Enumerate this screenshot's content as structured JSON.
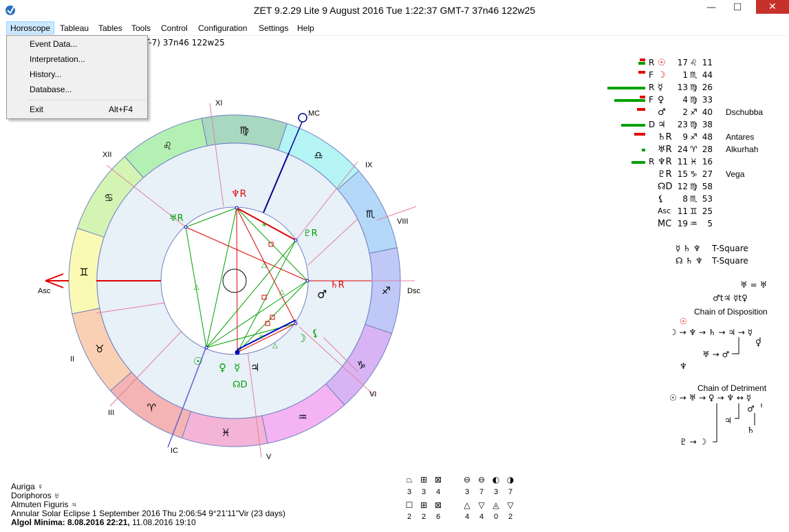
{
  "window": {
    "title": "ZET 9.2.29 Lite     9 August 2016   Tue     1:22:37 GMT-7 37n46   122w25",
    "minimize": "—",
    "maximize": "☐",
    "close": "✕"
  },
  "menubar": [
    "Horoscope",
    "Tableau",
    "Tables",
    "Tools",
    "Control",
    "Configuration",
    "Settings",
    "Help"
  ],
  "dropdown": {
    "items": [
      "Event Data...",
      "Interpretation...",
      "History...",
      "Database..."
    ],
    "exit": "Exit",
    "exit_accel": "Alt+F4"
  },
  "header_info": "T-7) 37n46  122w25",
  "wheel": {
    "houses": [
      "Asc",
      "II",
      "III",
      "IC",
      "V",
      "VI",
      "Dsc",
      "VIII",
      "IX",
      "MC",
      "XI",
      "XII"
    ],
    "signs": [
      "♊",
      "♋",
      "♌",
      "♍",
      "♎",
      "♏",
      "♐",
      "♑",
      "♒",
      "♓",
      "♈",
      "♉"
    ],
    "planet_glyphs": {
      "neptune_r": "♆R",
      "uranus_r": "♅R",
      "pluto_r": "♇R",
      "saturn_r": "♄R",
      "mars": "♂",
      "moon": "☽",
      "node": "☊",
      "mercury": "☿",
      "venus": "♀",
      "jupiter": "♃",
      "sun": "☉",
      "lilith": "⚸",
      "ceres": "⚳",
      "chiron_d": "☊D"
    },
    "colors": {
      "aries": "#f4b4b4",
      "taurus": "#fad0b4",
      "gemini": "#fafab4",
      "cancer": "#d4f4b4",
      "leo": "#b4f0b4",
      "virgo": "#a8d8c0",
      "libra": "#b4f4f4",
      "scorpio": "#b4d8f8",
      "sagittarius": "#c0c8f8",
      "capricorn": "#d8b4f4",
      "aquarius": "#f4b4f4",
      "pisces": "#f4b4d8",
      "inner": "#e8f0f8",
      "red": "#e00000",
      "green": "#00a000",
      "blue": "#0000c0"
    }
  },
  "planets": [
    {
      "flag": "R",
      "glyph": "☉",
      "deg": "17",
      "sign": "♌",
      "min": "11",
      "star": "",
      "red": 8,
      "green": 10,
      "color": "#e00000"
    },
    {
      "flag": "F",
      "glyph": "☽",
      "deg": "1",
      "sign": "♏",
      "min": "44",
      "star": "",
      "red": 10,
      "green": 0,
      "color": "#e00000"
    },
    {
      "flag": "R",
      "glyph": "☿",
      "deg": "13",
      "sign": "♍",
      "min": "26",
      "star": "",
      "red": 0,
      "green": 55,
      "color": "#000"
    },
    {
      "flag": "F",
      "glyph": "♀",
      "deg": "4",
      "sign": "♍",
      "min": "33",
      "star": "",
      "red": 8,
      "green": 45,
      "color": "#000"
    },
    {
      "flag": "",
      "glyph": "♂",
      "deg": "2",
      "sign": "♐",
      "min": "40",
      "star": "Dschubba",
      "red": 12,
      "green": 0,
      "color": "#000"
    },
    {
      "flag": "D",
      "glyph": "♃",
      "deg": "23",
      "sign": "♍",
      "min": "38",
      "star": "",
      "red": 0,
      "green": 35,
      "color": "#000"
    },
    {
      "flag": "",
      "glyph": "♄R",
      "deg": "9",
      "sign": "♐",
      "min": "48",
      "star": "Antares",
      "red": 16,
      "green": 0,
      "color": "#000"
    },
    {
      "flag": "",
      "glyph": "♅R",
      "deg": "24",
      "sign": "♈",
      "min": "28",
      "star": "Alkurhah",
      "red": 0,
      "green": 5,
      "color": "#000"
    },
    {
      "flag": "R",
      "glyph": "♆R",
      "deg": "11",
      "sign": "♓",
      "min": "16",
      "star": "",
      "red": 0,
      "green": 20,
      "color": "#000"
    },
    {
      "flag": "",
      "glyph": "♇R",
      "deg": "15",
      "sign": "♑",
      "min": "27",
      "star": "Vega",
      "red": 0,
      "green": 0,
      "color": "#000"
    },
    {
      "flag": "",
      "glyph": "☊D",
      "deg": "12",
      "sign": "♍",
      "min": "58",
      "star": "",
      "red": 0,
      "green": 0,
      "color": "#000"
    },
    {
      "flag": "",
      "glyph": "⚸",
      "deg": "8",
      "sign": "♏",
      "min": "53",
      "star": "",
      "red": 0,
      "green": 0,
      "color": "#000"
    },
    {
      "flag": "",
      "glyph": "Asc",
      "deg": "11",
      "sign": "♊",
      "min": "25",
      "star": "",
      "red": 0,
      "green": 0,
      "color": "#000"
    },
    {
      "flag": "",
      "glyph": "MC",
      "deg": "19",
      "sign": "♒",
      "min": "5",
      "star": "",
      "red": 0,
      "green": 0,
      "color": "#000"
    }
  ],
  "configurations": [
    {
      "glyphs": "☿ ♄ ♆",
      "name": "T-Square"
    },
    {
      "glyphs": "☊ ♄ ♆",
      "name": "T-Square"
    }
  ],
  "reception": {
    "line1": "♅ = ♅",
    "line2": "♂t♃ ☿t♀"
  },
  "chain_disposition": {
    "title": "Chain of Disposition",
    "top": "☉",
    "row1": "☽ → ♆ → ♄ → ♃ → ☿",
    "row2": "♅ → ♂",
    "row3": "♆",
    "side": "♀"
  },
  "chain_detriment": {
    "title": "Chain of Detriment",
    "row1": "☉ → ♅ → ♀ → ♆ ↔ ☿",
    "mid1": "♃",
    "mid2": "♂",
    "mid3": "♄",
    "row2": "♇ → ☽"
  },
  "bottom": {
    "auriga": "Auriga  ♀",
    "doriphoros": "Doriphoros  ♅",
    "almuten": "Almuten Figuris  ♃",
    "eclipse": "Annular Solar Eclipse 1 September 2016 Thu   2:06:54   9°21'11\"Vir (23 days)",
    "algol_bold": "Algol Minima: 8.08.2016 22:21,",
    "algol_rest": " 11.08.2016 19:10"
  },
  "stats": {
    "group1_syms": [
      "⏢",
      "⊞",
      "⊠"
    ],
    "group1_top": [
      "3",
      "3",
      "4"
    ],
    "group1_sym2": [
      "☐",
      "⊞",
      "⊠"
    ],
    "group1_bot": [
      "2",
      "2",
      "6"
    ],
    "group2_syms": [
      "⊖",
      "⊖",
      "◐",
      "◑"
    ],
    "group2_top": [
      "3",
      "7",
      "3",
      "7"
    ],
    "group2_sym2": [
      "△",
      "▽",
      "◬",
      "▽"
    ],
    "group2_bot": [
      "4",
      "4",
      "0",
      "2"
    ]
  }
}
